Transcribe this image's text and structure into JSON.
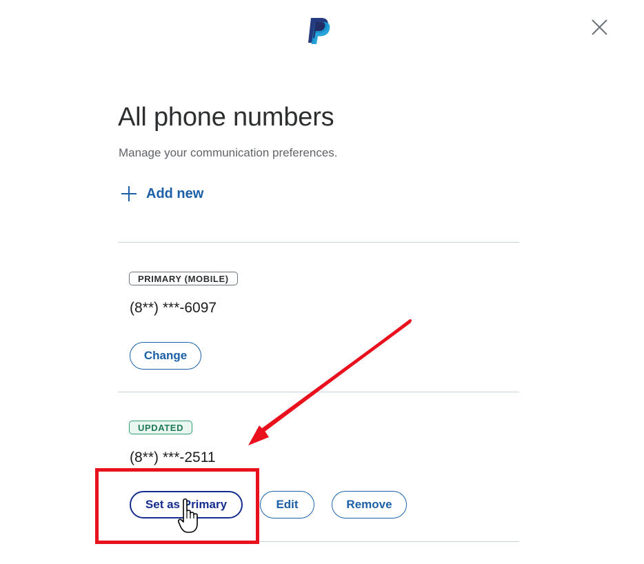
{
  "header": {
    "logo_icon": "paypal-logo-icon",
    "close_icon": "close-icon"
  },
  "page": {
    "title": "All phone numbers",
    "subtitle": "Manage your communication preferences."
  },
  "add_new": {
    "icon": "plus-icon",
    "label": "Add new"
  },
  "phones": [
    {
      "badge": "PRIMARY (MOBILE)",
      "number": "(8**) ***-6097",
      "actions": [
        "Change"
      ]
    },
    {
      "badge": "UPDATED",
      "number": "(8**) ***-2511",
      "actions": [
        "Set as Primary",
        "Edit",
        "Remove"
      ]
    }
  ],
  "annotations": {
    "highlight_color": "#e8111d",
    "arrow_color": "#e8111d",
    "cursor_icon": "hand-pointer-icon"
  },
  "colors": {
    "link_blue": "#1a5fa8",
    "primary_dark_blue": "#142c8e",
    "updated_green": "#2f9c72",
    "paypal_navy": "#253b80",
    "paypal_light": "#179bd7"
  }
}
